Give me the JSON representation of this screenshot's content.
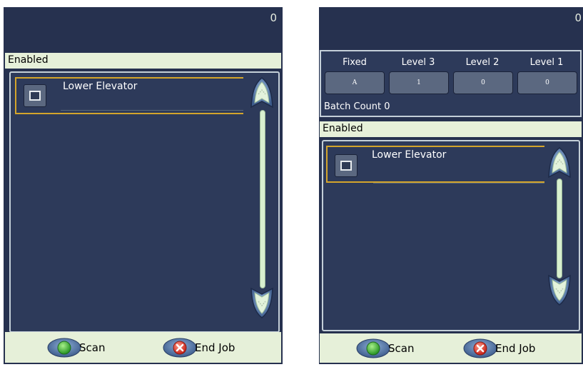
{
  "left": {
    "count": "0",
    "section_label": "Enabled",
    "items": [
      {
        "label": "Lower Elevator",
        "checked": false
      }
    ],
    "footer": {
      "scan_label": "Scan",
      "end_label": "End Job"
    }
  },
  "right": {
    "count": "0",
    "levels": [
      {
        "header": "Fixed",
        "value": "A"
      },
      {
        "header": "Level 3",
        "value": "1"
      },
      {
        "header": "Level 2",
        "value": "0"
      },
      {
        "header": "Level 1",
        "value": "0"
      }
    ],
    "batch_count": "Batch Count 0",
    "section_label": "Enabled",
    "items": [
      {
        "label": "Lower Elevator",
        "checked": false
      }
    ],
    "footer": {
      "scan_label": "Scan",
      "end_label": "End Job"
    }
  },
  "icons": {
    "scan": "green-circle-icon",
    "end_job": "red-x-icon",
    "checkbox": "checkbox-icon",
    "scroll_up": "scroll-up-arrow-icon",
    "scroll_down": "scroll-down-arrow-icon"
  },
  "colors": {
    "panel_bg": "#26314f",
    "header_bg": "#e6f0d9",
    "selection_border": "#d4a52b",
    "scan_green": "#3cb043",
    "end_red": "#d9362b"
  }
}
